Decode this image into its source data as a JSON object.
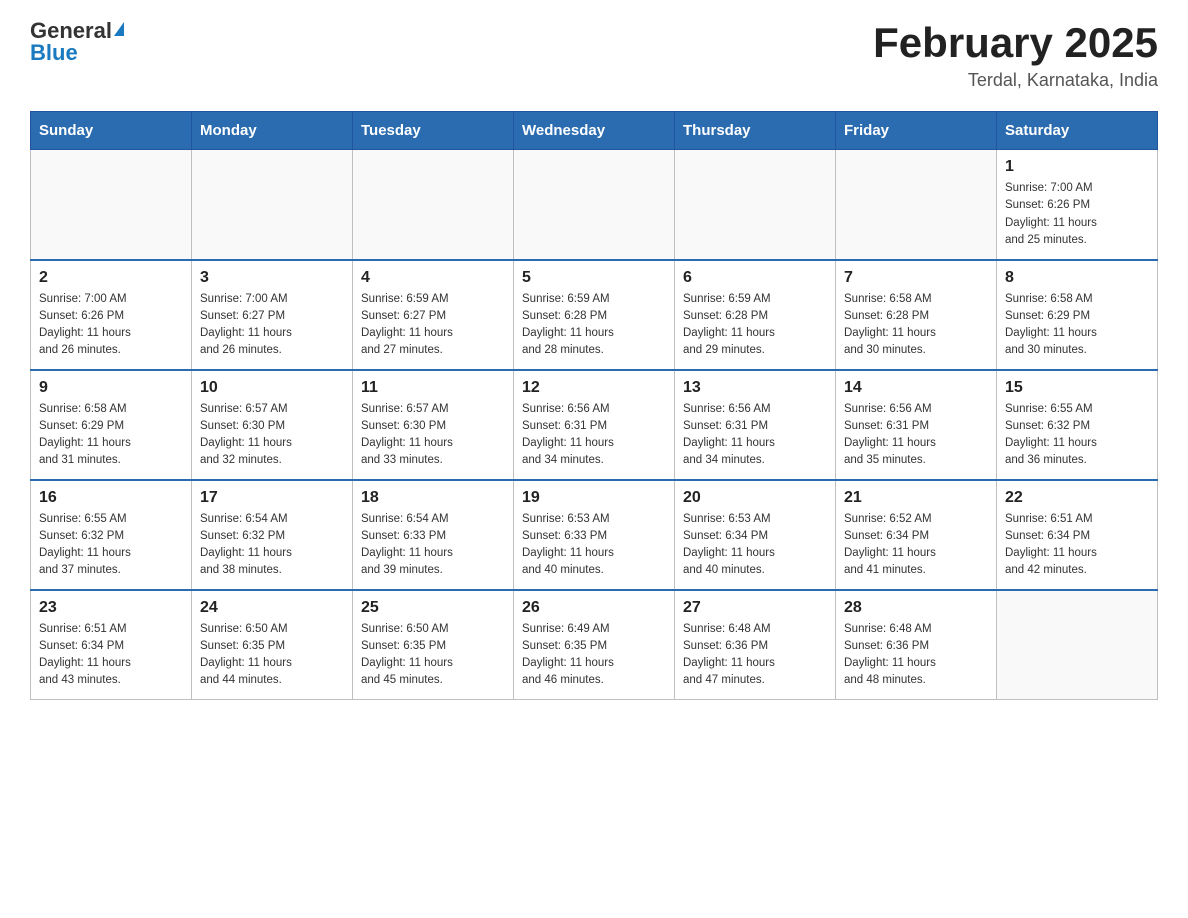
{
  "header": {
    "logo_general": "General",
    "logo_blue": "Blue",
    "month_title": "February 2025",
    "location": "Terdal, Karnataka, India"
  },
  "weekdays": [
    "Sunday",
    "Monday",
    "Tuesday",
    "Wednesday",
    "Thursday",
    "Friday",
    "Saturday"
  ],
  "weeks": [
    [
      {
        "day": "",
        "info": ""
      },
      {
        "day": "",
        "info": ""
      },
      {
        "day": "",
        "info": ""
      },
      {
        "day": "",
        "info": ""
      },
      {
        "day": "",
        "info": ""
      },
      {
        "day": "",
        "info": ""
      },
      {
        "day": "1",
        "info": "Sunrise: 7:00 AM\nSunset: 6:26 PM\nDaylight: 11 hours\nand 25 minutes."
      }
    ],
    [
      {
        "day": "2",
        "info": "Sunrise: 7:00 AM\nSunset: 6:26 PM\nDaylight: 11 hours\nand 26 minutes."
      },
      {
        "day": "3",
        "info": "Sunrise: 7:00 AM\nSunset: 6:27 PM\nDaylight: 11 hours\nand 26 minutes."
      },
      {
        "day": "4",
        "info": "Sunrise: 6:59 AM\nSunset: 6:27 PM\nDaylight: 11 hours\nand 27 minutes."
      },
      {
        "day": "5",
        "info": "Sunrise: 6:59 AM\nSunset: 6:28 PM\nDaylight: 11 hours\nand 28 minutes."
      },
      {
        "day": "6",
        "info": "Sunrise: 6:59 AM\nSunset: 6:28 PM\nDaylight: 11 hours\nand 29 minutes."
      },
      {
        "day": "7",
        "info": "Sunrise: 6:58 AM\nSunset: 6:28 PM\nDaylight: 11 hours\nand 30 minutes."
      },
      {
        "day": "8",
        "info": "Sunrise: 6:58 AM\nSunset: 6:29 PM\nDaylight: 11 hours\nand 30 minutes."
      }
    ],
    [
      {
        "day": "9",
        "info": "Sunrise: 6:58 AM\nSunset: 6:29 PM\nDaylight: 11 hours\nand 31 minutes."
      },
      {
        "day": "10",
        "info": "Sunrise: 6:57 AM\nSunset: 6:30 PM\nDaylight: 11 hours\nand 32 minutes."
      },
      {
        "day": "11",
        "info": "Sunrise: 6:57 AM\nSunset: 6:30 PM\nDaylight: 11 hours\nand 33 minutes."
      },
      {
        "day": "12",
        "info": "Sunrise: 6:56 AM\nSunset: 6:31 PM\nDaylight: 11 hours\nand 34 minutes."
      },
      {
        "day": "13",
        "info": "Sunrise: 6:56 AM\nSunset: 6:31 PM\nDaylight: 11 hours\nand 34 minutes."
      },
      {
        "day": "14",
        "info": "Sunrise: 6:56 AM\nSunset: 6:31 PM\nDaylight: 11 hours\nand 35 minutes."
      },
      {
        "day": "15",
        "info": "Sunrise: 6:55 AM\nSunset: 6:32 PM\nDaylight: 11 hours\nand 36 minutes."
      }
    ],
    [
      {
        "day": "16",
        "info": "Sunrise: 6:55 AM\nSunset: 6:32 PM\nDaylight: 11 hours\nand 37 minutes."
      },
      {
        "day": "17",
        "info": "Sunrise: 6:54 AM\nSunset: 6:32 PM\nDaylight: 11 hours\nand 38 minutes."
      },
      {
        "day": "18",
        "info": "Sunrise: 6:54 AM\nSunset: 6:33 PM\nDaylight: 11 hours\nand 39 minutes."
      },
      {
        "day": "19",
        "info": "Sunrise: 6:53 AM\nSunset: 6:33 PM\nDaylight: 11 hours\nand 40 minutes."
      },
      {
        "day": "20",
        "info": "Sunrise: 6:53 AM\nSunset: 6:34 PM\nDaylight: 11 hours\nand 40 minutes."
      },
      {
        "day": "21",
        "info": "Sunrise: 6:52 AM\nSunset: 6:34 PM\nDaylight: 11 hours\nand 41 minutes."
      },
      {
        "day": "22",
        "info": "Sunrise: 6:51 AM\nSunset: 6:34 PM\nDaylight: 11 hours\nand 42 minutes."
      }
    ],
    [
      {
        "day": "23",
        "info": "Sunrise: 6:51 AM\nSunset: 6:34 PM\nDaylight: 11 hours\nand 43 minutes."
      },
      {
        "day": "24",
        "info": "Sunrise: 6:50 AM\nSunset: 6:35 PM\nDaylight: 11 hours\nand 44 minutes."
      },
      {
        "day": "25",
        "info": "Sunrise: 6:50 AM\nSunset: 6:35 PM\nDaylight: 11 hours\nand 45 minutes."
      },
      {
        "day": "26",
        "info": "Sunrise: 6:49 AM\nSunset: 6:35 PM\nDaylight: 11 hours\nand 46 minutes."
      },
      {
        "day": "27",
        "info": "Sunrise: 6:48 AM\nSunset: 6:36 PM\nDaylight: 11 hours\nand 47 minutes."
      },
      {
        "day": "28",
        "info": "Sunrise: 6:48 AM\nSunset: 6:36 PM\nDaylight: 11 hours\nand 48 minutes."
      },
      {
        "day": "",
        "info": ""
      }
    ]
  ]
}
